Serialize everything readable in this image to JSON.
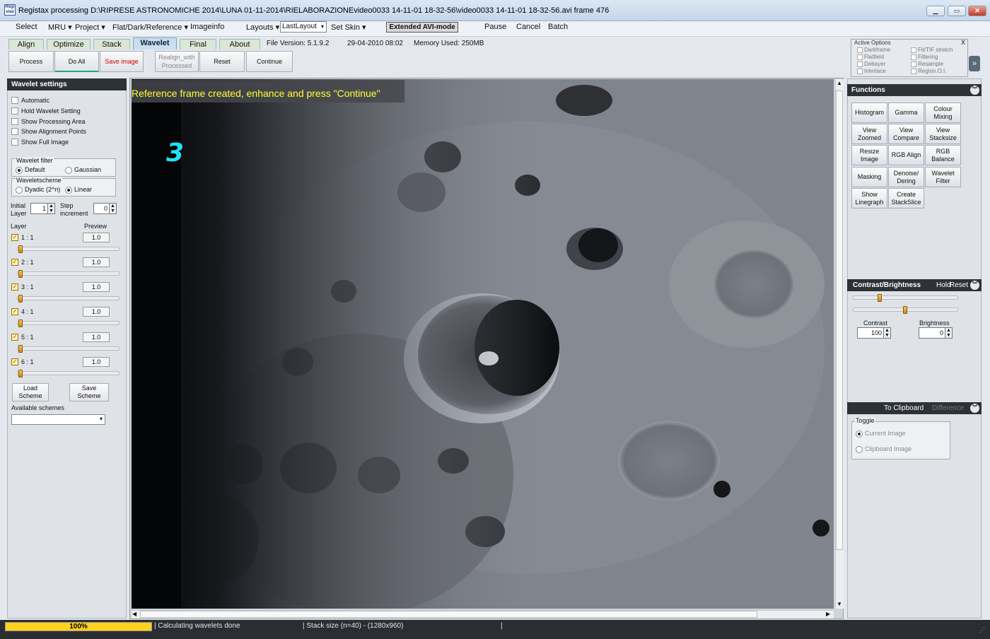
{
  "window": {
    "title": "Registax processing D:\\RIPRESE ASTRONOMICHE 2014\\LUNA 01-11-2014\\RIELABORAZIONEvideo0033 14-11-01 18-32-56\\video0033 14-11-01 18-32-56.avi frame 476",
    "app_icon_text": "Regi stax"
  },
  "menu": {
    "select": "Select",
    "mru": "MRU ▾",
    "project": "Project ▾",
    "flatdark": "Flat/Dark/Reference ▾",
    "imageinfo": "Imageinfo",
    "layouts": "Layouts ▾",
    "layout_value": "LastLayout",
    "set_skin": "Set Skin ▾",
    "extended": "Extended AVI-mode",
    "pause": "Pause",
    "cancel": "Cancel",
    "batch": "Batch"
  },
  "tabs": [
    "Align",
    "Optimize",
    "Stack",
    "Wavelet",
    "Final",
    "About"
  ],
  "info": {
    "file_version": "File Version: 5.1.9.2",
    "date": "29-04-2010 08:02",
    "memory": "Memory Used: 250MB"
  },
  "toolbar": {
    "process": "Process",
    "do_all": "Do All",
    "save_image": "Save image",
    "realign": "Realign_with Processed",
    "reset": "Reset",
    "continue": "Continue"
  },
  "active_options": {
    "title": "Active Options",
    "close": "X",
    "items": [
      "Darkframe",
      "Flatfield",
      "Debayer",
      "Interlace",
      "Fit/TIF stretch",
      "Filtering",
      "Resample",
      "Region.O.I."
    ],
    "expand": "»"
  },
  "wavelet": {
    "title": "Wavelet settings",
    "checks": [
      "Automatic",
      "Hold Wavelet Setting",
      "Show Processing Area",
      "Show Alignment Points",
      "Show Full Image"
    ],
    "filter_label": "Wavelet filter",
    "filter_default": "Default",
    "filter_gaussian": "Gaussian",
    "scheme_label": "Waveletscheme",
    "scheme_dyadic": "Dyadic (2^n)",
    "scheme_linear": "Linear",
    "initial_layer_label": "Initial Layer",
    "initial_layer_value": "1",
    "step_label": "Step increment",
    "step_value": "0",
    "layer_col": "Layer",
    "preview_col": "Preview",
    "layers": [
      {
        "name": "1 : 1",
        "preview": "1.0"
      },
      {
        "name": "2 : 1",
        "preview": "1.0"
      },
      {
        "name": "3 : 1",
        "preview": "1.0"
      },
      {
        "name": "4 : 1",
        "preview": "1.0"
      },
      {
        "name": "5 : 1",
        "preview": "1.0"
      },
      {
        "name": "6 : 1",
        "preview": "1.0"
      }
    ],
    "load_scheme": "Load Scheme",
    "save_scheme": "Save Scheme",
    "available_schemes": "Available schemes"
  },
  "image": {
    "message": "Reference frame created, enhance and press \"Continue\"",
    "frame_label": "3"
  },
  "functions": {
    "title": "Functions",
    "buttons": [
      "Histogram",
      "Gamma",
      "Colour Mixing",
      "View Zoomed",
      "View Compare",
      "View Stacksize",
      "Resize Image",
      "RGB Align",
      "RGB Balance",
      "Masking",
      "Denoise/ Dering",
      "Wavelet Filter",
      "Show Linegraph",
      "Create StackSlice"
    ]
  },
  "contrast": {
    "title": "Contrast/Brightness",
    "hold": "Hold",
    "reset": "Reset",
    "contrast_label": "Contrast",
    "contrast_value": "100",
    "brightness_label": "Brightness",
    "brightness_value": "0"
  },
  "clipboard": {
    "title": "To Clipboard",
    "difference": "Difference",
    "toggle": "Toggle",
    "current": "Current Image",
    "clipboard_image": "Clipboard Image"
  },
  "status": {
    "progress": "100%",
    "progress_value": 1.0,
    "message": "Calculating wavelets done",
    "stack": "Stack size (n=40) - (1280x960)"
  }
}
